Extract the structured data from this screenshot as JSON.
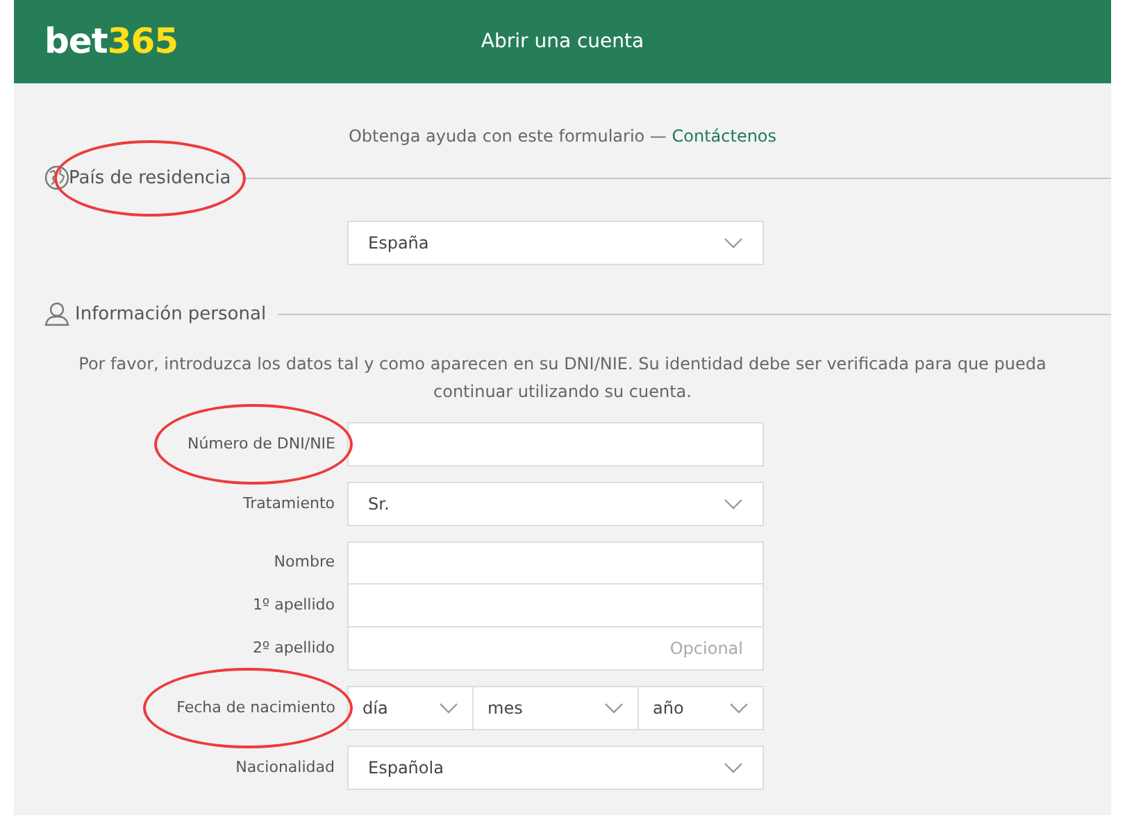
{
  "header": {
    "logo": {
      "text": "bet",
      "accent": "365"
    },
    "title": "Abrir una cuenta"
  },
  "help": {
    "text": "Obtenga ayuda con este formulario —",
    "link": "Contáctenos"
  },
  "sections": [
    {
      "title": "País de residencia",
      "circled": true,
      "fields": [
        {
          "kind": "select",
          "value": "España"
        }
      ]
    },
    {
      "title": "Información personal",
      "circled": false,
      "intro": "Por favor, introduzca los datos tal y como aparecen en su DNI/NIE. Su identidad debe ser verificada para que pueda continuar utilizando su cuenta.",
      "fields": [
        {
          "kind": "text",
          "label": "Número de DNI/NIE",
          "circled": true
        },
        {
          "kind": "select",
          "label": "Tratamiento",
          "value": "Sr.",
          "circled": false
        },
        {
          "kind": "group",
          "rows": [
            {
              "label": "Nombre",
              "circled": false
            },
            {
              "label": "1º apellido",
              "circled": false
            },
            {
              "label": "2º apellido",
              "placeholder": "Opcional",
              "circled": false
            }
          ]
        },
        {
          "kind": "date",
          "label": "Fecha de nacimiento",
          "circled": true,
          "parts": [
            "día",
            "mes",
            "año"
          ]
        },
        {
          "kind": "select",
          "label": "Nacionalidad",
          "value": "Española",
          "circled": false
        }
      ]
    }
  ]
}
